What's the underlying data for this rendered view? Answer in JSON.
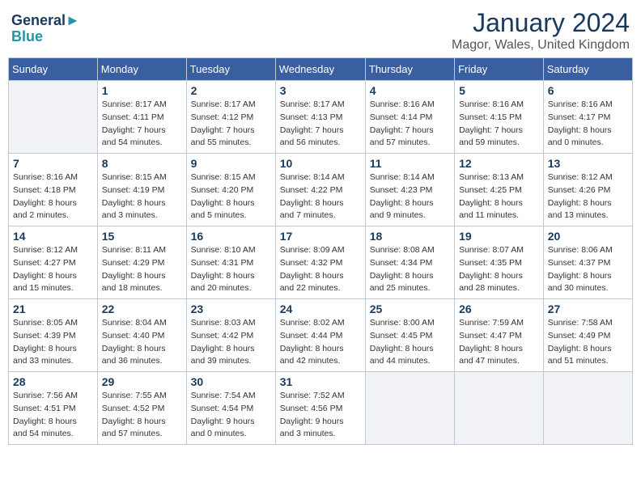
{
  "logo": {
    "line1": "General",
    "line2": "Blue"
  },
  "title": "January 2024",
  "subtitle": "Magor, Wales, United Kingdom",
  "weekdays": [
    "Sunday",
    "Monday",
    "Tuesday",
    "Wednesday",
    "Thursday",
    "Friday",
    "Saturday"
  ],
  "weeks": [
    [
      {
        "day": "",
        "details": []
      },
      {
        "day": "1",
        "details": [
          "Sunrise: 8:17 AM",
          "Sunset: 4:11 PM",
          "Daylight: 7 hours",
          "and 54 minutes."
        ]
      },
      {
        "day": "2",
        "details": [
          "Sunrise: 8:17 AM",
          "Sunset: 4:12 PM",
          "Daylight: 7 hours",
          "and 55 minutes."
        ]
      },
      {
        "day": "3",
        "details": [
          "Sunrise: 8:17 AM",
          "Sunset: 4:13 PM",
          "Daylight: 7 hours",
          "and 56 minutes."
        ]
      },
      {
        "day": "4",
        "details": [
          "Sunrise: 8:16 AM",
          "Sunset: 4:14 PM",
          "Daylight: 7 hours",
          "and 57 minutes."
        ]
      },
      {
        "day": "5",
        "details": [
          "Sunrise: 8:16 AM",
          "Sunset: 4:15 PM",
          "Daylight: 7 hours",
          "and 59 minutes."
        ]
      },
      {
        "day": "6",
        "details": [
          "Sunrise: 8:16 AM",
          "Sunset: 4:17 PM",
          "Daylight: 8 hours",
          "and 0 minutes."
        ]
      }
    ],
    [
      {
        "day": "7",
        "details": [
          "Sunrise: 8:16 AM",
          "Sunset: 4:18 PM",
          "Daylight: 8 hours",
          "and 2 minutes."
        ]
      },
      {
        "day": "8",
        "details": [
          "Sunrise: 8:15 AM",
          "Sunset: 4:19 PM",
          "Daylight: 8 hours",
          "and 3 minutes."
        ]
      },
      {
        "day": "9",
        "details": [
          "Sunrise: 8:15 AM",
          "Sunset: 4:20 PM",
          "Daylight: 8 hours",
          "and 5 minutes."
        ]
      },
      {
        "day": "10",
        "details": [
          "Sunrise: 8:14 AM",
          "Sunset: 4:22 PM",
          "Daylight: 8 hours",
          "and 7 minutes."
        ]
      },
      {
        "day": "11",
        "details": [
          "Sunrise: 8:14 AM",
          "Sunset: 4:23 PM",
          "Daylight: 8 hours",
          "and 9 minutes."
        ]
      },
      {
        "day": "12",
        "details": [
          "Sunrise: 8:13 AM",
          "Sunset: 4:25 PM",
          "Daylight: 8 hours",
          "and 11 minutes."
        ]
      },
      {
        "day": "13",
        "details": [
          "Sunrise: 8:12 AM",
          "Sunset: 4:26 PM",
          "Daylight: 8 hours",
          "and 13 minutes."
        ]
      }
    ],
    [
      {
        "day": "14",
        "details": [
          "Sunrise: 8:12 AM",
          "Sunset: 4:27 PM",
          "Daylight: 8 hours",
          "and 15 minutes."
        ]
      },
      {
        "day": "15",
        "details": [
          "Sunrise: 8:11 AM",
          "Sunset: 4:29 PM",
          "Daylight: 8 hours",
          "and 18 minutes."
        ]
      },
      {
        "day": "16",
        "details": [
          "Sunrise: 8:10 AM",
          "Sunset: 4:31 PM",
          "Daylight: 8 hours",
          "and 20 minutes."
        ]
      },
      {
        "day": "17",
        "details": [
          "Sunrise: 8:09 AM",
          "Sunset: 4:32 PM",
          "Daylight: 8 hours",
          "and 22 minutes."
        ]
      },
      {
        "day": "18",
        "details": [
          "Sunrise: 8:08 AM",
          "Sunset: 4:34 PM",
          "Daylight: 8 hours",
          "and 25 minutes."
        ]
      },
      {
        "day": "19",
        "details": [
          "Sunrise: 8:07 AM",
          "Sunset: 4:35 PM",
          "Daylight: 8 hours",
          "and 28 minutes."
        ]
      },
      {
        "day": "20",
        "details": [
          "Sunrise: 8:06 AM",
          "Sunset: 4:37 PM",
          "Daylight: 8 hours",
          "and 30 minutes."
        ]
      }
    ],
    [
      {
        "day": "21",
        "details": [
          "Sunrise: 8:05 AM",
          "Sunset: 4:39 PM",
          "Daylight: 8 hours",
          "and 33 minutes."
        ]
      },
      {
        "day": "22",
        "details": [
          "Sunrise: 8:04 AM",
          "Sunset: 4:40 PM",
          "Daylight: 8 hours",
          "and 36 minutes."
        ]
      },
      {
        "day": "23",
        "details": [
          "Sunrise: 8:03 AM",
          "Sunset: 4:42 PM",
          "Daylight: 8 hours",
          "and 39 minutes."
        ]
      },
      {
        "day": "24",
        "details": [
          "Sunrise: 8:02 AM",
          "Sunset: 4:44 PM",
          "Daylight: 8 hours",
          "and 42 minutes."
        ]
      },
      {
        "day": "25",
        "details": [
          "Sunrise: 8:00 AM",
          "Sunset: 4:45 PM",
          "Daylight: 8 hours",
          "and 44 minutes."
        ]
      },
      {
        "day": "26",
        "details": [
          "Sunrise: 7:59 AM",
          "Sunset: 4:47 PM",
          "Daylight: 8 hours",
          "and 47 minutes."
        ]
      },
      {
        "day": "27",
        "details": [
          "Sunrise: 7:58 AM",
          "Sunset: 4:49 PM",
          "Daylight: 8 hours",
          "and 51 minutes."
        ]
      }
    ],
    [
      {
        "day": "28",
        "details": [
          "Sunrise: 7:56 AM",
          "Sunset: 4:51 PM",
          "Daylight: 8 hours",
          "and 54 minutes."
        ]
      },
      {
        "day": "29",
        "details": [
          "Sunrise: 7:55 AM",
          "Sunset: 4:52 PM",
          "Daylight: 8 hours",
          "and 57 minutes."
        ]
      },
      {
        "day": "30",
        "details": [
          "Sunrise: 7:54 AM",
          "Sunset: 4:54 PM",
          "Daylight: 9 hours",
          "and 0 minutes."
        ]
      },
      {
        "day": "31",
        "details": [
          "Sunrise: 7:52 AM",
          "Sunset: 4:56 PM",
          "Daylight: 9 hours",
          "and 3 minutes."
        ]
      },
      {
        "day": "",
        "details": []
      },
      {
        "day": "",
        "details": []
      },
      {
        "day": "",
        "details": []
      }
    ]
  ]
}
